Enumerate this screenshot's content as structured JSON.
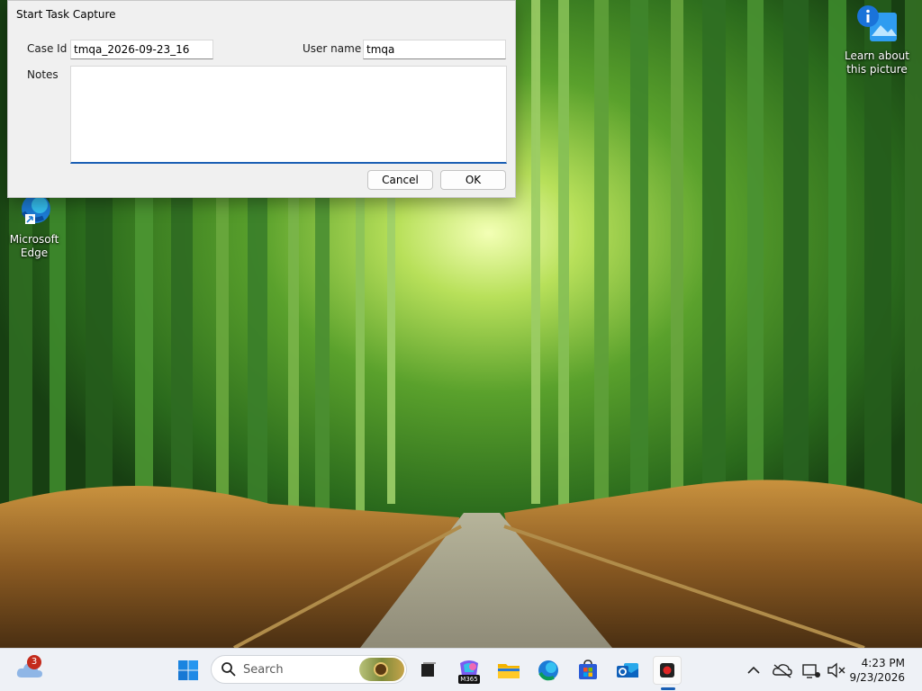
{
  "desktop": {
    "icons": [
      {
        "label": "Microsoft Edge"
      },
      {
        "label": "Learn about this picture"
      }
    ]
  },
  "dialog": {
    "title": "Start Task Capture",
    "case_id_label": "Case Id",
    "case_id_value": "tmqa_2026-09-23_16",
    "user_name_label": "User name",
    "user_name_value": "tmqa",
    "notes_label": "Notes",
    "notes_value": "",
    "cancel_label": "Cancel",
    "ok_label": "OK"
  },
  "taskbar": {
    "weather_badge": "3",
    "search_placeholder": "Search",
    "m365_badge": "M365",
    "apps": [
      "start-icon",
      "search",
      "copilot-widget-icon",
      "task-view-icon",
      "m365-copilot-icon",
      "file-explorer-icon",
      "edge-icon",
      "store-icon",
      "outlook-icon",
      "recorder-icon"
    ],
    "clock": {
      "time": "4:23 PM",
      "date": "9/23/2026"
    }
  },
  "colors": {
    "accent": "#1a5fb4",
    "taskbar_bg": "#eef1f6",
    "dialog_bg": "#f0f0f0"
  }
}
